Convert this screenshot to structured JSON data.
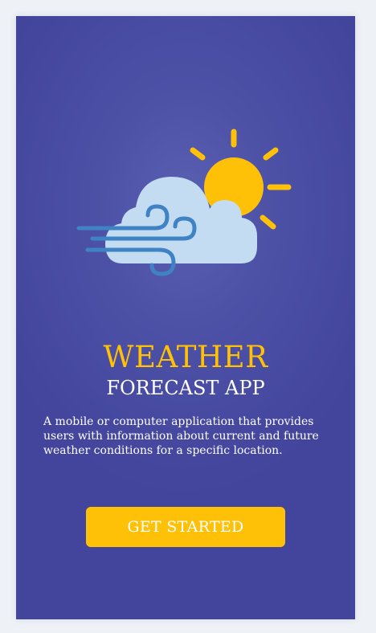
{
  "onboarding": {
    "illustration_icon": "cloud-sun-wind-icon",
    "title": "WEATHER",
    "subtitle": "FORECAST APP",
    "description": "A mobile or computer application that provides users with information about current and future weather conditions for a specific location.",
    "cta_label": "GET STARTED"
  },
  "colors": {
    "background": "#43449c",
    "accent": "#ffc107",
    "cloud": "#c3dcf2",
    "wind": "#3f83c4",
    "text": "#ffffff",
    "page": "#eef2f7"
  }
}
